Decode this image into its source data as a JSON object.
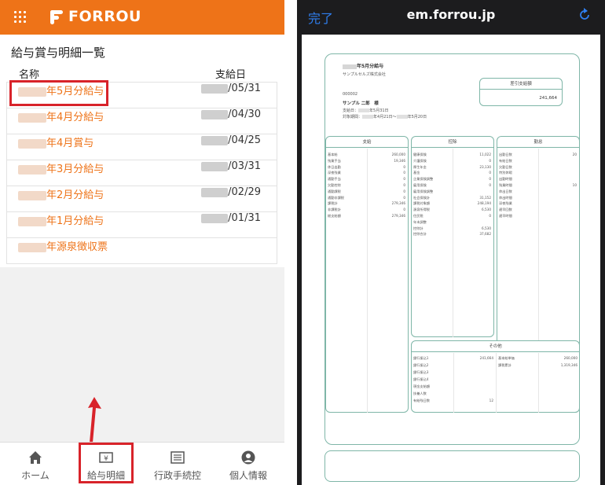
{
  "left": {
    "brand": "FORROU",
    "page_title": "給与賞与明細一覧",
    "col_name": "名称",
    "col_date": "支給日",
    "rows": [
      {
        "name": "年5月分給与",
        "date": "/05/31"
      },
      {
        "name": "年4月分給与",
        "date": "/04/30"
      },
      {
        "name": "年4月賞与",
        "date": "/04/25"
      },
      {
        "name": "年3月分給与",
        "date": "/03/31"
      },
      {
        "name": "年2月分給与",
        "date": "/02/29"
      },
      {
        "name": "年1月分給与",
        "date": "/01/31"
      },
      {
        "name": "年源泉徴収票",
        "date": ""
      }
    ],
    "nav": [
      {
        "label": "ホーム",
        "icon": "home-icon"
      },
      {
        "label": "給与明細",
        "icon": "yen-icon"
      },
      {
        "label": "行政手続控",
        "icon": "document-icon"
      },
      {
        "label": "個人情報",
        "icon": "person-icon"
      }
    ],
    "accent": "#ee7318",
    "highlight": "#d8232a"
  },
  "right": {
    "done": "完了",
    "url": "em.forrou.jp",
    "doc": {
      "title": "年5月分給与",
      "company": "サンプルセルズ株式会社",
      "emp_code": "000002",
      "emp_name": "サンプル 二郎　様",
      "pay_date_label": "支給日：",
      "pay_date": "年5月31日",
      "period_label": "対象期間：",
      "period_from": "年4月21日～",
      "period_to": "年5月20日",
      "net_label": "差引支給額",
      "net_value": "241,664",
      "pay": {
        "title": "支給",
        "items": [
          {
            "k": "基本給",
            "v": "260,000"
          },
          {
            "k": "残業手当",
            "v": "19,346"
          },
          {
            "k": "休日出勤",
            "v": "0"
          },
          {
            "k": "深夜残業",
            "v": "0"
          },
          {
            "k": "通勤手当",
            "v": "0"
          },
          {
            "k": "欠勤控除",
            "v": "0"
          },
          {
            "k": "通勤課税",
            "v": "0"
          },
          {
            "k": "通勤非課税",
            "v": "0"
          },
          {
            "k": "課税計",
            "v": "279,346"
          },
          {
            "k": "非課税計",
            "v": "0"
          },
          {
            "k": "総支給額",
            "v": "279,346"
          }
        ]
      },
      "deduct": {
        "title": "控除",
        "items": [
          {
            "k": "健康保険",
            "v": "11,022"
          },
          {
            "k": "介護保険",
            "v": "0"
          },
          {
            "k": "厚生年金",
            "v": "23,130"
          },
          {
            "k": "基金",
            "v": "0"
          },
          {
            "k": "企業保険調整",
            "v": "0"
          },
          {
            "k": "雇用保険",
            "v": "0"
          },
          {
            "k": "雇用保険調整",
            "v": ""
          },
          {
            "k": "社会保険計",
            "v": "31,152"
          },
          {
            "k": "課税対象額",
            "v": "248,194"
          },
          {
            "k": "源泉所得税",
            "v": "6,530"
          },
          {
            "k": "住民税",
            "v": "0"
          },
          {
            "k": "年末調整",
            "v": ""
          },
          {
            "k": "控除計",
            "v": "6,530"
          },
          {
            "k": "控除合計",
            "v": "37,682"
          }
        ]
      },
      "attend": {
        "title": "勤怠",
        "items": [
          {
            "k": "出勤日数",
            "v": "20"
          },
          {
            "k": "有給日数",
            "v": ""
          },
          {
            "k": "欠勤日数",
            "v": ""
          },
          {
            "k": "特別休暇",
            "v": ""
          },
          {
            "k": "出勤時間",
            "v": ""
          },
          {
            "k": "残業時間",
            "v": "10"
          },
          {
            "k": "休出日数",
            "v": ""
          },
          {
            "k": "休出時間",
            "v": ""
          },
          {
            "k": "深夜残業",
            "v": ""
          },
          {
            "k": "遅早回数",
            "v": ""
          },
          {
            "k": "遅早時間",
            "v": ""
          }
        ]
      },
      "other": {
        "title": "その他",
        "left": [
          {
            "k": "銀行振込1",
            "v": "241,664"
          },
          {
            "k": "銀行振込2",
            "v": ""
          },
          {
            "k": "銀行振込3",
            "v": ""
          },
          {
            "k": "銀行振込4",
            "v": ""
          },
          {
            "k": "現金支給額",
            "v": ""
          },
          {
            "k": "扶養人数",
            "v": ""
          },
          {
            "k": "有給残日数",
            "v": "12"
          }
        ],
        "right": [
          {
            "k": "基本給単価",
            "v": "260,000"
          },
          {
            "k": "課税累計",
            "v": "1,319,346"
          }
        ]
      }
    }
  }
}
